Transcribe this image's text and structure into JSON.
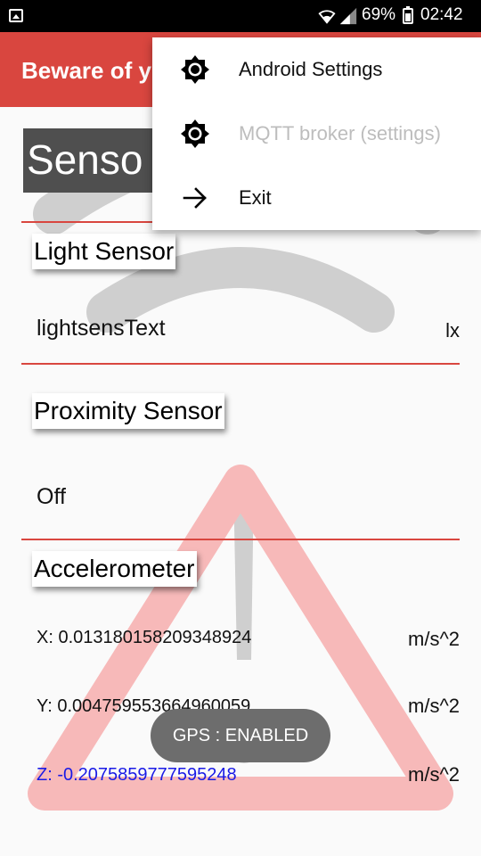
{
  "status_bar": {
    "battery_percent": "69%",
    "time": "02:42",
    "icons": [
      "gallery-icon",
      "wifi-icon",
      "signal-icon",
      "battery-icon"
    ]
  },
  "app_bar": {
    "title": "Beware of y",
    "color": "#d9463f"
  },
  "main": {
    "header": "Senso",
    "light": {
      "label": "Light Sensor",
      "value": "lightsensText",
      "unit": "lx"
    },
    "proximity": {
      "label": "Proximity Sensor",
      "value": "Off"
    },
    "accelerometer": {
      "label": "Accelerometer",
      "x": "X: 0.013180158209348924",
      "y": "Y: 0.004759553664960059",
      "z": "Z: -0.2075859777595248",
      "unit": "m/s^2"
    }
  },
  "toast": {
    "text": "GPS : ENABLED"
  },
  "menu": {
    "items": [
      {
        "label": "Android Settings",
        "icon": "brightness-icon",
        "enabled": true
      },
      {
        "label": "MQTT broker (settings)",
        "icon": "brightness-icon",
        "enabled": false
      },
      {
        "label": "Exit",
        "icon": "arrow-right-icon",
        "enabled": true
      }
    ]
  }
}
